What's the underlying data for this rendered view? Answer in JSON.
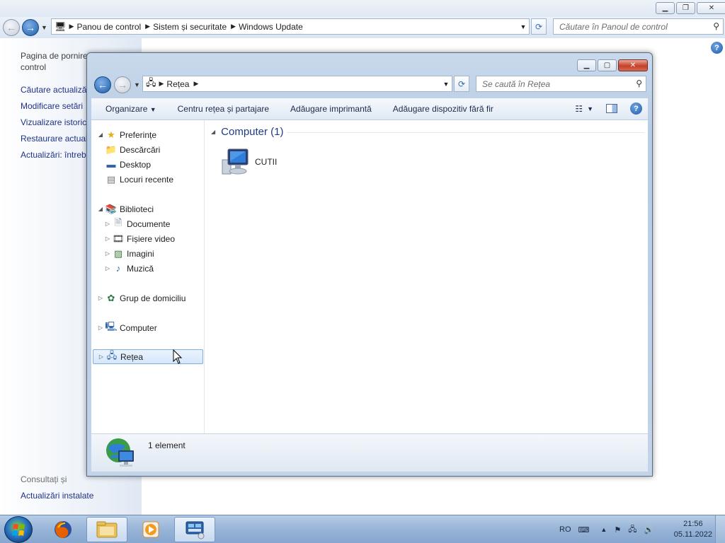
{
  "background_window": {
    "breadcrumb": [
      "Panou de control",
      "Sistem și securitate",
      "Windows Update"
    ],
    "search_placeholder": "Căutare în Panoul de control",
    "sidebar": {
      "home_link_line1": "Pagina de pornire",
      "home_link_line2": "control",
      "links": [
        "Căutare actualizări",
        "Modificare setări",
        "Vizualizare istoric",
        "Restaurare actualizări",
        "Actualizări: întrebări"
      ],
      "see_also": "Consultați și",
      "installed_updates": "Actualizări instalate"
    }
  },
  "explorer": {
    "breadcrumb": [
      "Rețea"
    ],
    "search_placeholder": "Se caută în Rețea",
    "toolbar": {
      "organize": "Organizare",
      "network_center": "Centru rețea și partajare",
      "add_printer": "Adăugare imprimantă",
      "add_wireless": "Adăugare dispozitiv fără fir"
    },
    "nav_tree": {
      "favorites": "Preferințe",
      "downloads": "Descărcări",
      "desktop": "Desktop",
      "recent": "Locuri recente",
      "libraries": "Biblioteci",
      "documents": "Documente",
      "videos": "Fișiere video",
      "pictures": "Imagini",
      "music": "Muzică",
      "homegroup": "Grup de domiciliu",
      "computer": "Computer",
      "network": "Rețea"
    },
    "group_header": "Computer (1)",
    "items": [
      "CUTII"
    ],
    "status": "1 element"
  },
  "taskbar": {
    "language": "RO",
    "time": "21:56",
    "date": "05.11.2022"
  },
  "colors": {
    "link": "#1e3287",
    "group_header": "#1e3a8a",
    "close_button": "#c4412a",
    "taskbar": "#9ab6d8"
  }
}
